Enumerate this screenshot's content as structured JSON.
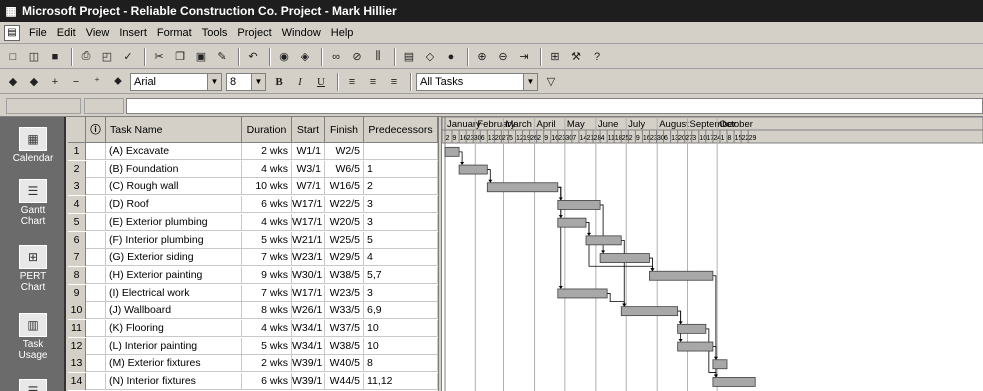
{
  "window": {
    "title": "Microsoft Project - Reliable Construction Co. Project - Mark Hillier"
  },
  "menu": [
    "File",
    "Edit",
    "View",
    "Insert",
    "Format",
    "Tools",
    "Project",
    "Window",
    "Help"
  ],
  "formatting": {
    "font": "Arial",
    "size": "8",
    "filter": "All Tasks"
  },
  "view_bar": [
    "Calendar",
    "Gantt Chart",
    "PERT Chart",
    "Task Usage"
  ],
  "table": {
    "headers": {
      "info": "",
      "name": "Task Name",
      "duration": "Duration",
      "start": "Start",
      "finish": "Finish",
      "pred": "Predecessors"
    },
    "rows": [
      {
        "id": "1",
        "name": "(A) Excavate",
        "duration": "2 wks",
        "start": "W1/1",
        "finish": "W2/5",
        "pred": ""
      },
      {
        "id": "2",
        "name": "(B) Foundation",
        "duration": "4 wks",
        "start": "W3/1",
        "finish": "W6/5",
        "pred": "1"
      },
      {
        "id": "3",
        "name": "(C) Rough wall",
        "duration": "10 wks",
        "start": "W7/1",
        "finish": "W16/5",
        "pred": "2"
      },
      {
        "id": "4",
        "name": "(D) Roof",
        "duration": "6 wks",
        "start": "W17/1",
        "finish": "W22/5",
        "pred": "3"
      },
      {
        "id": "5",
        "name": "(E) Exterior plumbing",
        "duration": "4 wks",
        "start": "W17/1",
        "finish": "W20/5",
        "pred": "3"
      },
      {
        "id": "6",
        "name": "(F) Interior plumbing",
        "duration": "5 wks",
        "start": "W21/1",
        "finish": "W25/5",
        "pred": "5"
      },
      {
        "id": "7",
        "name": "(G) Exterior siding",
        "duration": "7 wks",
        "start": "W23/1",
        "finish": "W29/5",
        "pred": "4"
      },
      {
        "id": "8",
        "name": "(H) Exterior painting",
        "duration": "9 wks",
        "start": "W30/1",
        "finish": "W38/5",
        "pred": "5,7"
      },
      {
        "id": "9",
        "name": "(I) Electrical work",
        "duration": "7 wks",
        "start": "W17/1",
        "finish": "W23/5",
        "pred": "3"
      },
      {
        "id": "10",
        "name": "(J) Wallboard",
        "duration": "8 wks",
        "start": "W26/1",
        "finish": "W33/5",
        "pred": "6,9"
      },
      {
        "id": "11",
        "name": "(K) Flooring",
        "duration": "4 wks",
        "start": "W34/1",
        "finish": "W37/5",
        "pred": "10"
      },
      {
        "id": "12",
        "name": "(L) Interior painting",
        "duration": "5 wks",
        "start": "W34/1",
        "finish": "W38/5",
        "pred": "10"
      },
      {
        "id": "13",
        "name": "(M) Exterior fixtures",
        "duration": "2 wks",
        "start": "W39/1",
        "finish": "W40/5",
        "pred": "8"
      },
      {
        "id": "14",
        "name": "(N) Interior fixtures",
        "duration": "6 wks",
        "start": "W39/1",
        "finish": "W44/5",
        "pred": "11,12"
      }
    ]
  },
  "gantt": {
    "months": [
      "January",
      "February",
      "March",
      "April",
      "May",
      "June",
      "July",
      "August",
      "September",
      "October"
    ],
    "days": "2 9 16 23 30 6 13 20 27 5 12 19 26 2 9 16 23 30 7 14 21 28 4 11 18 25 2 9 16 23 30 6 13 20 27 3 10 17 24 1 8 15 22 29",
    "bar_color": "#a8a8a8"
  }
}
